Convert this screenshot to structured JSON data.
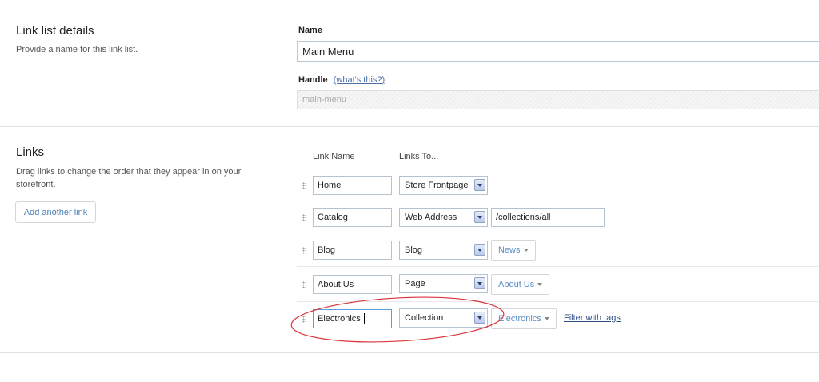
{
  "details": {
    "title": "Link list details",
    "description": "Provide a name for this link list.",
    "name_label": "Name",
    "name_value": "Main Menu",
    "handle_label": "Handle",
    "handle_help": "(what's this?)",
    "handle_value": "main-menu"
  },
  "links_section": {
    "title": "Links",
    "description": "Drag links to change the order that they appear in on your storefront.",
    "add_button": "Add another link",
    "col_link_name": "Link Name",
    "col_links_to": "Links To..."
  },
  "rows": [
    {
      "name": "Home",
      "type": "Store Frontpage"
    },
    {
      "name": "Catalog",
      "type": "Web Address",
      "address": "/collections/all"
    },
    {
      "name": "Blog",
      "type": "Blog",
      "target": "News"
    },
    {
      "name": "About Us",
      "type": "Page",
      "target": "About Us"
    },
    {
      "name": "Electronics",
      "type": "Collection",
      "target": "Electronics",
      "filter_link": "Filter with tags"
    }
  ],
  "annotation": {
    "color": "#d9353a"
  }
}
